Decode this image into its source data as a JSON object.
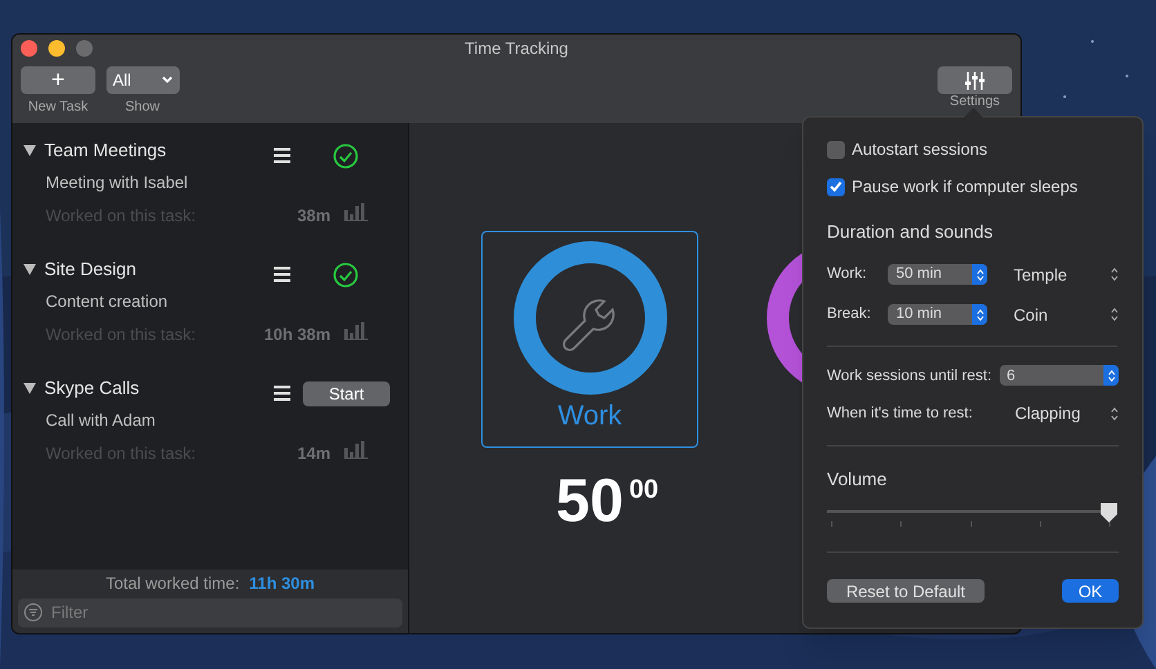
{
  "window": {
    "title": "Time Tracking"
  },
  "toolbar": {
    "new_task": {
      "icon": "+",
      "label": "New Task"
    },
    "show": {
      "value": "All",
      "label": "Show"
    },
    "settings": {
      "label": "Settings"
    }
  },
  "tasks": [
    {
      "name": "Team Meetings",
      "description": "Meeting with Isabel",
      "worked_label": "Worked on this task:",
      "worked": "38m",
      "expanded": true,
      "kind": "done"
    },
    {
      "name": "Site Design",
      "description": "Content creation",
      "worked_label": "Worked on this task:",
      "worked": "10h 38m",
      "expanded": true,
      "kind": "done"
    },
    {
      "name": "Skype Calls",
      "description": "Call with Adam",
      "worked_label": "Worked on this task:",
      "worked": "14m",
      "expanded": true,
      "kind": "start",
      "action": "Start"
    }
  ],
  "footer": {
    "total_label": "Total worked time:",
    "total_value": "11h 30m",
    "filter": {
      "placeholder": "Filter"
    }
  },
  "sessions": [
    {
      "label": "Work",
      "selected": true,
      "color": "#2e8fd8"
    },
    {
      "selected": false,
      "color": "#b452d8"
    }
  ],
  "timer": {
    "minutes": "50",
    "seconds": "00"
  },
  "settings": {
    "checkboxes": [
      {
        "label": "Autostart sessions",
        "checked": false
      },
      {
        "label": "Pause work if computer sleeps",
        "checked": true
      }
    ],
    "section_title": "Duration and sounds",
    "durations": [
      {
        "label": "Work:",
        "value": "50 min",
        "sound": "Temple"
      },
      {
        "label": "Break:",
        "value": "10 min",
        "sound": "Coin"
      }
    ],
    "sessions_until_rest": {
      "label": "Work sessions until rest:",
      "value": "6"
    },
    "rest_sound": {
      "label": "When it's time to rest:",
      "value": "Clapping"
    },
    "volume": {
      "label": "Volume",
      "level": 1
    },
    "buttons": [
      {
        "label": "Reset to Default",
        "kind": "secondary"
      },
      {
        "label": "OK",
        "kind": "primary"
      }
    ]
  }
}
